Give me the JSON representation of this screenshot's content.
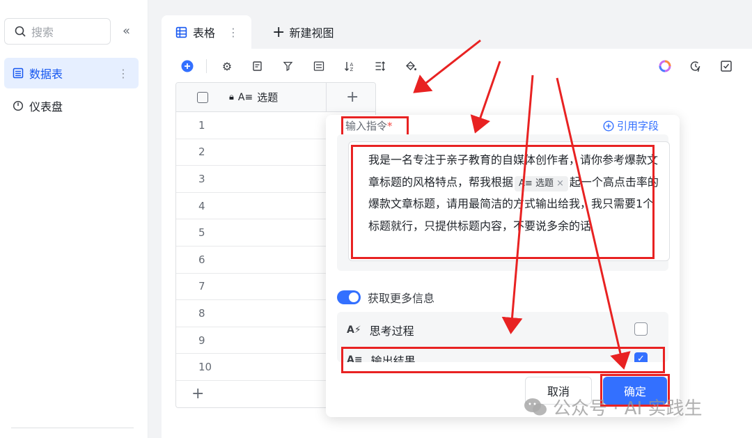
{
  "sidebar": {
    "search_placeholder": "搜索",
    "items": [
      {
        "label": "数据表",
        "active": true
      },
      {
        "label": "仪表盘",
        "active": false
      }
    ]
  },
  "tabs": {
    "table_tab": "表格",
    "new_view": "新建视图"
  },
  "grid": {
    "column_name": "选题",
    "row_numbers": [
      "1",
      "2",
      "3",
      "4",
      "5",
      "6",
      "7",
      "8",
      "9",
      "10"
    ]
  },
  "popup": {
    "instruction_label": "输入指令",
    "required_mark": "*",
    "ref_field": "引用字段",
    "prompt_part1": "我是一名专注于亲子教育的自媒体创作者，请你参考爆款文章标题的风格特点，帮我根据",
    "chip_label": "选题",
    "prompt_part2": "起一个高点击率的爆款文章标题，请用最简洁的方式输出给我，我只需要1个标题就行，只提供标题内容，不要说多余的话",
    "toggle_label": "获取更多信息",
    "option_thinking": "思考过程",
    "option_output": "输出结果",
    "cancel": "取消",
    "confirm": "确定"
  },
  "watermark": "公众号 · AI 实践生",
  "colors": {
    "accent": "#3370ff",
    "annotation": "#e82222"
  }
}
